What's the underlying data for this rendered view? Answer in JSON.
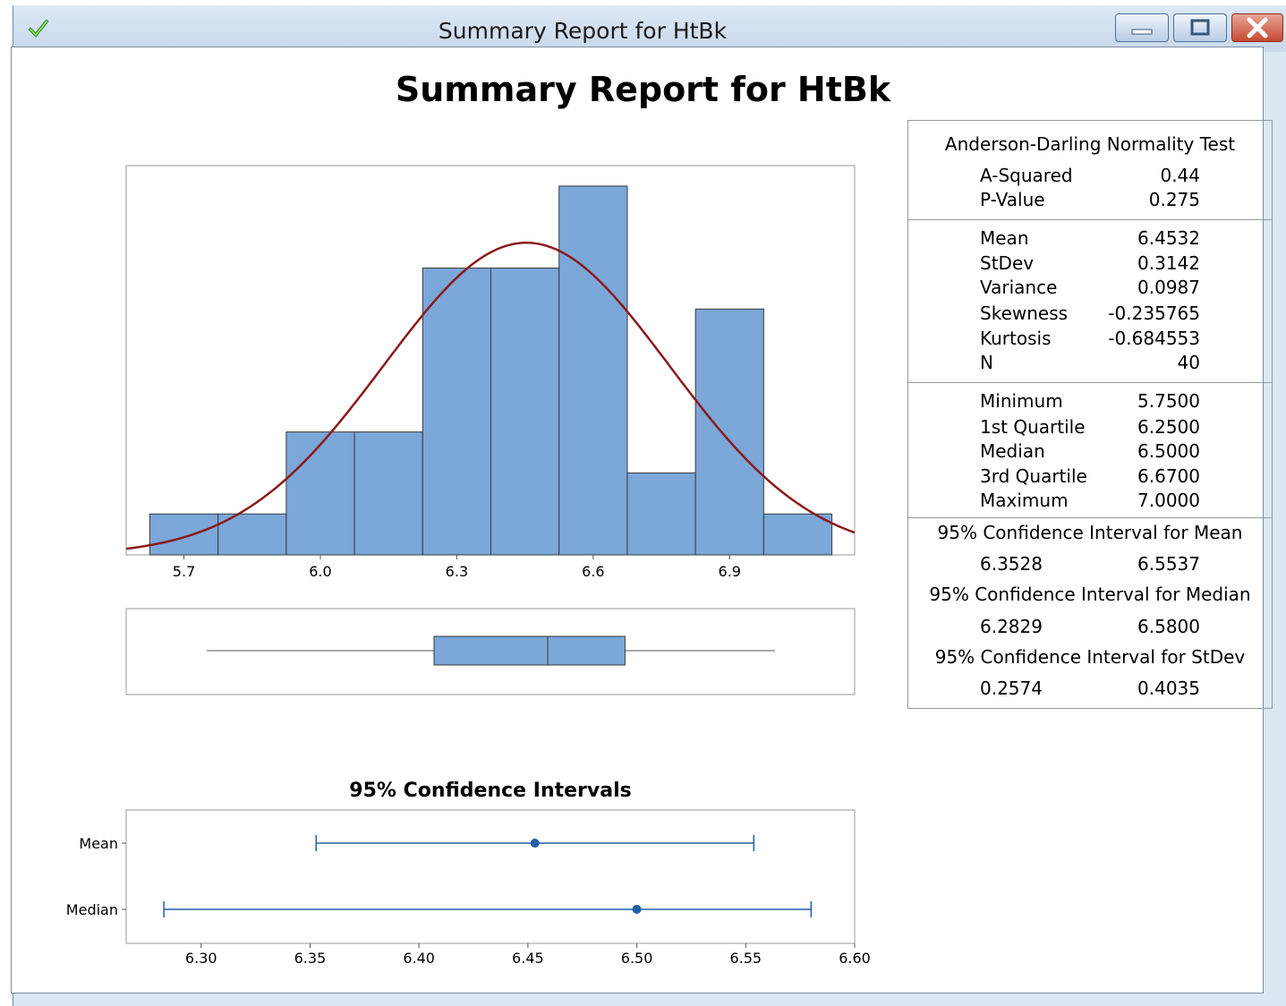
{
  "window": {
    "title": "Summary Report for HtBk"
  },
  "report": {
    "title": "Summary Report for HtBk",
    "histogram": {
      "x_ticks": [
        "5.7",
        "6.0",
        "6.3",
        "6.6",
        "6.9"
      ]
    },
    "ci_chart": {
      "title": "95% Confidence Intervals",
      "y_labels": [
        "Mean",
        "Median"
      ],
      "x_ticks": [
        "6.30",
        "6.35",
        "6.40",
        "6.45",
        "6.50",
        "6.55",
        "6.60"
      ]
    },
    "stats": {
      "normality_header": "Anderson-Darling Normality Test",
      "normality": [
        {
          "label": "A-Squared",
          "value": "0.44"
        },
        {
          "label": "P-Value",
          "value": "0.275"
        }
      ],
      "moments": [
        {
          "label": "Mean",
          "value": "6.4532"
        },
        {
          "label": "StDev",
          "value": "0.3142"
        },
        {
          "label": "Variance",
          "value": "0.0987"
        },
        {
          "label": "Skewness",
          "value": "-0.235765"
        },
        {
          "label": "Kurtosis",
          "value": "-0.684553"
        },
        {
          "label": "N",
          "value": "40"
        }
      ],
      "quantiles": [
        {
          "label": "Minimum",
          "value": "5.7500"
        },
        {
          "label": "1st Quartile",
          "value": "6.2500"
        },
        {
          "label": "Median",
          "value": "6.5000"
        },
        {
          "label": "3rd Quartile",
          "value": "6.6700"
        },
        {
          "label": "Maximum",
          "value": "7.0000"
        }
      ],
      "ci_mean_header": "95% Confidence Interval for Mean",
      "ci_mean": {
        "low": "6.3528",
        "high": "6.5537"
      },
      "ci_median_header": "95% Confidence Interval for Median",
      "ci_median": {
        "low": "6.2829",
        "high": "6.5800"
      },
      "ci_stdev_header": "95% Confidence Interval for StDev",
      "ci_stdev": {
        "low": "0.2574",
        "high": "0.4035"
      }
    }
  },
  "chart_data": [
    {
      "type": "bar",
      "bin_width": 0.15,
      "bin_starts": [
        5.625,
        5.775,
        5.925,
        6.075,
        6.225,
        6.375,
        6.525,
        6.675,
        6.825,
        6.975
      ],
      "values": [
        1,
        1,
        3,
        3,
        7,
        7,
        9,
        2,
        6,
        1
      ],
      "xlim": [
        5.573,
        7.175
      ],
      "ylim": [
        0,
        9.5
      ],
      "x_ticks": [
        5.7,
        6.0,
        6.3,
        6.6,
        6.9
      ],
      "overlay": {
        "type": "normal_curve",
        "mean": 6.4532,
        "stdev": 0.3142,
        "n": 40,
        "color": "#8b1a1a"
      },
      "bar_color": "#7ba7d9",
      "grid": false
    },
    {
      "type": "boxplot",
      "min": 5.75,
      "q1": 6.25,
      "median": 6.5,
      "q3": 6.67,
      "max": 7.0,
      "xlim": [
        5.573,
        7.175
      ],
      "color": "#7ba7d9"
    },
    {
      "type": "interval",
      "title": "95% Confidence Intervals",
      "xlim": [
        5.2,
        6.6
      ],
      "x_ticks": [
        6.3,
        6.35,
        6.4,
        6.45,
        6.5,
        6.55,
        6.6
      ],
      "xlim_visible": [
        6.2656,
        6.6
      ],
      "series": [
        {
          "name": "Mean",
          "center": 6.4532,
          "low": 6.3528,
          "high": 6.5537
        },
        {
          "name": "Median",
          "center": 6.5,
          "low": 6.2829,
          "high": 6.58
        }
      ],
      "color": "#1f5fa8"
    }
  ]
}
